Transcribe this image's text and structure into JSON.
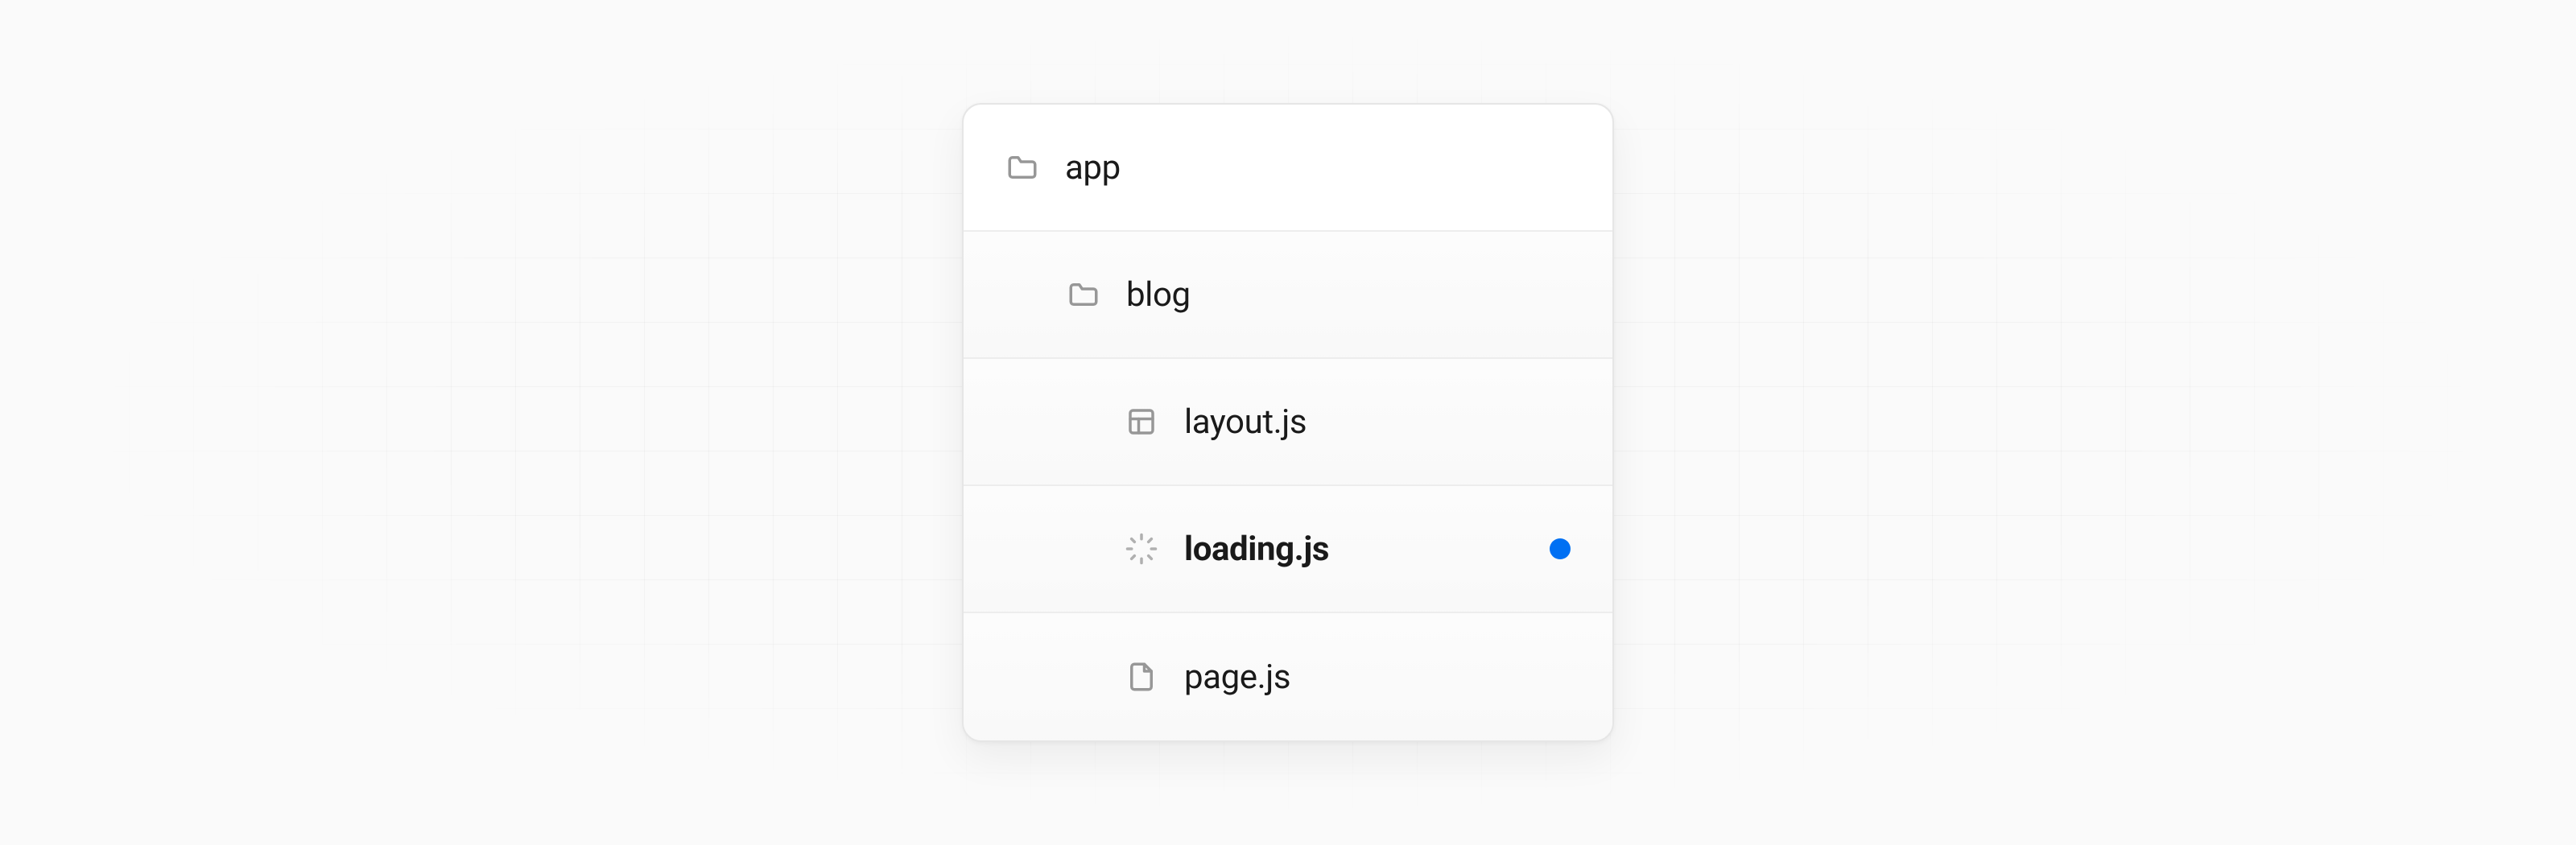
{
  "tree": {
    "root": {
      "name": "app",
      "icon": "folder"
    },
    "child": {
      "name": "blog",
      "icon": "folder"
    },
    "files": [
      {
        "name": "layout.js",
        "icon": "layout",
        "active": false,
        "bold": false
      },
      {
        "name": "loading.js",
        "icon": "spinner",
        "active": true,
        "bold": true
      },
      {
        "name": "page.js",
        "icon": "file",
        "active": false,
        "bold": false
      }
    ]
  },
  "colors": {
    "accent": "#0070f3",
    "iconStroke": "#979797",
    "border": "#e6e6e6"
  }
}
